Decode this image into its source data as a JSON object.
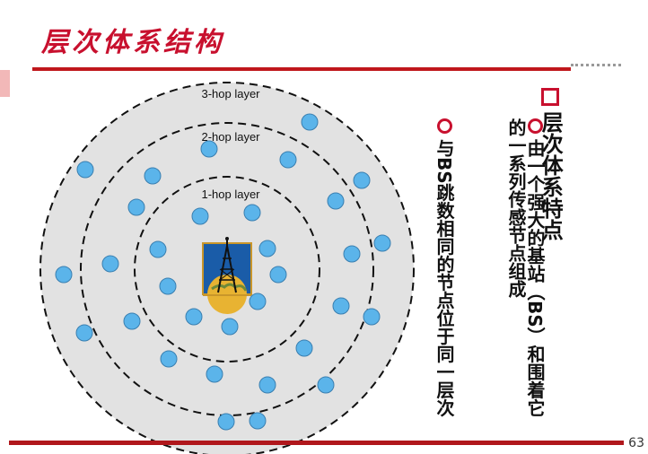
{
  "slide": {
    "title": "层次体系结构",
    "page_number": "63"
  },
  "diagram": {
    "layer_labels": [
      "3-hop layer",
      "2-hop layer",
      "1-hop layer"
    ],
    "node_color": "#5bb4ea",
    "area_color": "#e2e2e2",
    "base_station_icon": "radio-tower-globe-icon"
  },
  "content": {
    "heading": "层次体系特点",
    "bullet_1": "由一个强大的基站（BS）和围着它的一系列传感节点组成",
    "bullet_2": "与BS跳数相同的节点位于同一层次"
  },
  "colors": {
    "accent": "#c8102e",
    "rule": "#c0171c"
  }
}
